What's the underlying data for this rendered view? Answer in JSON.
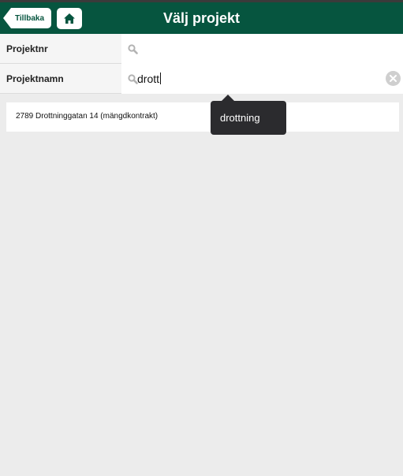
{
  "header": {
    "title": "Välj projekt",
    "back_label": "Tillbaka",
    "home_icon": "home-icon",
    "background_color": "#06553f"
  },
  "filters": {
    "project_number": {
      "label": "Projektnr",
      "value": "",
      "icon": "search-icon"
    },
    "project_name": {
      "label": "Projektnamn",
      "value": "drott",
      "icon": "search-icon",
      "clear_icon": "clear-icon"
    }
  },
  "results": [
    {
      "text": "2789 Drottninggatan 14 (mängdkontrakt)"
    }
  ],
  "autocomplete": {
    "suggestion": "drottning"
  }
}
